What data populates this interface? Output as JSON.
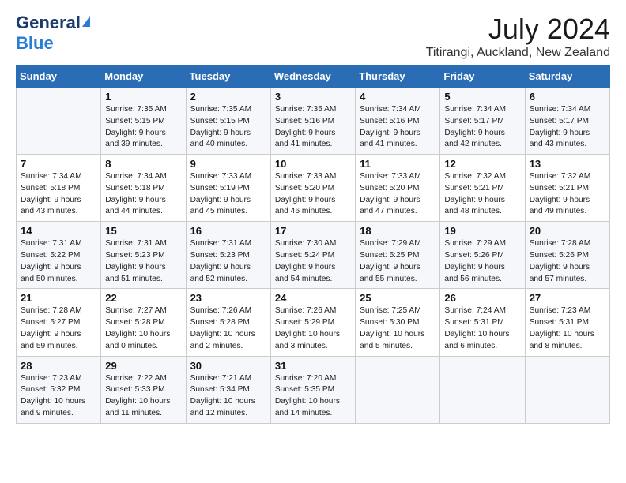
{
  "logo": {
    "general": "General",
    "blue": "Blue"
  },
  "title": {
    "month": "July 2024",
    "location": "Titirangi, Auckland, New Zealand"
  },
  "days_of_week": [
    "Sunday",
    "Monday",
    "Tuesday",
    "Wednesday",
    "Thursday",
    "Friday",
    "Saturday"
  ],
  "weeks": [
    [
      {
        "day": "",
        "info": ""
      },
      {
        "day": "1",
        "info": "Sunrise: 7:35 AM\nSunset: 5:15 PM\nDaylight: 9 hours\nand 39 minutes."
      },
      {
        "day": "2",
        "info": "Sunrise: 7:35 AM\nSunset: 5:15 PM\nDaylight: 9 hours\nand 40 minutes."
      },
      {
        "day": "3",
        "info": "Sunrise: 7:35 AM\nSunset: 5:16 PM\nDaylight: 9 hours\nand 41 minutes."
      },
      {
        "day": "4",
        "info": "Sunrise: 7:34 AM\nSunset: 5:16 PM\nDaylight: 9 hours\nand 41 minutes."
      },
      {
        "day": "5",
        "info": "Sunrise: 7:34 AM\nSunset: 5:17 PM\nDaylight: 9 hours\nand 42 minutes."
      },
      {
        "day": "6",
        "info": "Sunrise: 7:34 AM\nSunset: 5:17 PM\nDaylight: 9 hours\nand 43 minutes."
      }
    ],
    [
      {
        "day": "7",
        "info": "Sunrise: 7:34 AM\nSunset: 5:18 PM\nDaylight: 9 hours\nand 43 minutes."
      },
      {
        "day": "8",
        "info": "Sunrise: 7:34 AM\nSunset: 5:18 PM\nDaylight: 9 hours\nand 44 minutes."
      },
      {
        "day": "9",
        "info": "Sunrise: 7:33 AM\nSunset: 5:19 PM\nDaylight: 9 hours\nand 45 minutes."
      },
      {
        "day": "10",
        "info": "Sunrise: 7:33 AM\nSunset: 5:20 PM\nDaylight: 9 hours\nand 46 minutes."
      },
      {
        "day": "11",
        "info": "Sunrise: 7:33 AM\nSunset: 5:20 PM\nDaylight: 9 hours\nand 47 minutes."
      },
      {
        "day": "12",
        "info": "Sunrise: 7:32 AM\nSunset: 5:21 PM\nDaylight: 9 hours\nand 48 minutes."
      },
      {
        "day": "13",
        "info": "Sunrise: 7:32 AM\nSunset: 5:21 PM\nDaylight: 9 hours\nand 49 minutes."
      }
    ],
    [
      {
        "day": "14",
        "info": "Sunrise: 7:31 AM\nSunset: 5:22 PM\nDaylight: 9 hours\nand 50 minutes."
      },
      {
        "day": "15",
        "info": "Sunrise: 7:31 AM\nSunset: 5:23 PM\nDaylight: 9 hours\nand 51 minutes."
      },
      {
        "day": "16",
        "info": "Sunrise: 7:31 AM\nSunset: 5:23 PM\nDaylight: 9 hours\nand 52 minutes."
      },
      {
        "day": "17",
        "info": "Sunrise: 7:30 AM\nSunset: 5:24 PM\nDaylight: 9 hours\nand 54 minutes."
      },
      {
        "day": "18",
        "info": "Sunrise: 7:29 AM\nSunset: 5:25 PM\nDaylight: 9 hours\nand 55 minutes."
      },
      {
        "day": "19",
        "info": "Sunrise: 7:29 AM\nSunset: 5:26 PM\nDaylight: 9 hours\nand 56 minutes."
      },
      {
        "day": "20",
        "info": "Sunrise: 7:28 AM\nSunset: 5:26 PM\nDaylight: 9 hours\nand 57 minutes."
      }
    ],
    [
      {
        "day": "21",
        "info": "Sunrise: 7:28 AM\nSunset: 5:27 PM\nDaylight: 9 hours\nand 59 minutes."
      },
      {
        "day": "22",
        "info": "Sunrise: 7:27 AM\nSunset: 5:28 PM\nDaylight: 10 hours\nand 0 minutes."
      },
      {
        "day": "23",
        "info": "Sunrise: 7:26 AM\nSunset: 5:28 PM\nDaylight: 10 hours\nand 2 minutes."
      },
      {
        "day": "24",
        "info": "Sunrise: 7:26 AM\nSunset: 5:29 PM\nDaylight: 10 hours\nand 3 minutes."
      },
      {
        "day": "25",
        "info": "Sunrise: 7:25 AM\nSunset: 5:30 PM\nDaylight: 10 hours\nand 5 minutes."
      },
      {
        "day": "26",
        "info": "Sunrise: 7:24 AM\nSunset: 5:31 PM\nDaylight: 10 hours\nand 6 minutes."
      },
      {
        "day": "27",
        "info": "Sunrise: 7:23 AM\nSunset: 5:31 PM\nDaylight: 10 hours\nand 8 minutes."
      }
    ],
    [
      {
        "day": "28",
        "info": "Sunrise: 7:23 AM\nSunset: 5:32 PM\nDaylight: 10 hours\nand 9 minutes."
      },
      {
        "day": "29",
        "info": "Sunrise: 7:22 AM\nSunset: 5:33 PM\nDaylight: 10 hours\nand 11 minutes."
      },
      {
        "day": "30",
        "info": "Sunrise: 7:21 AM\nSunset: 5:34 PM\nDaylight: 10 hours\nand 12 minutes."
      },
      {
        "day": "31",
        "info": "Sunrise: 7:20 AM\nSunset: 5:35 PM\nDaylight: 10 hours\nand 14 minutes."
      },
      {
        "day": "",
        "info": ""
      },
      {
        "day": "",
        "info": ""
      },
      {
        "day": "",
        "info": ""
      }
    ]
  ]
}
